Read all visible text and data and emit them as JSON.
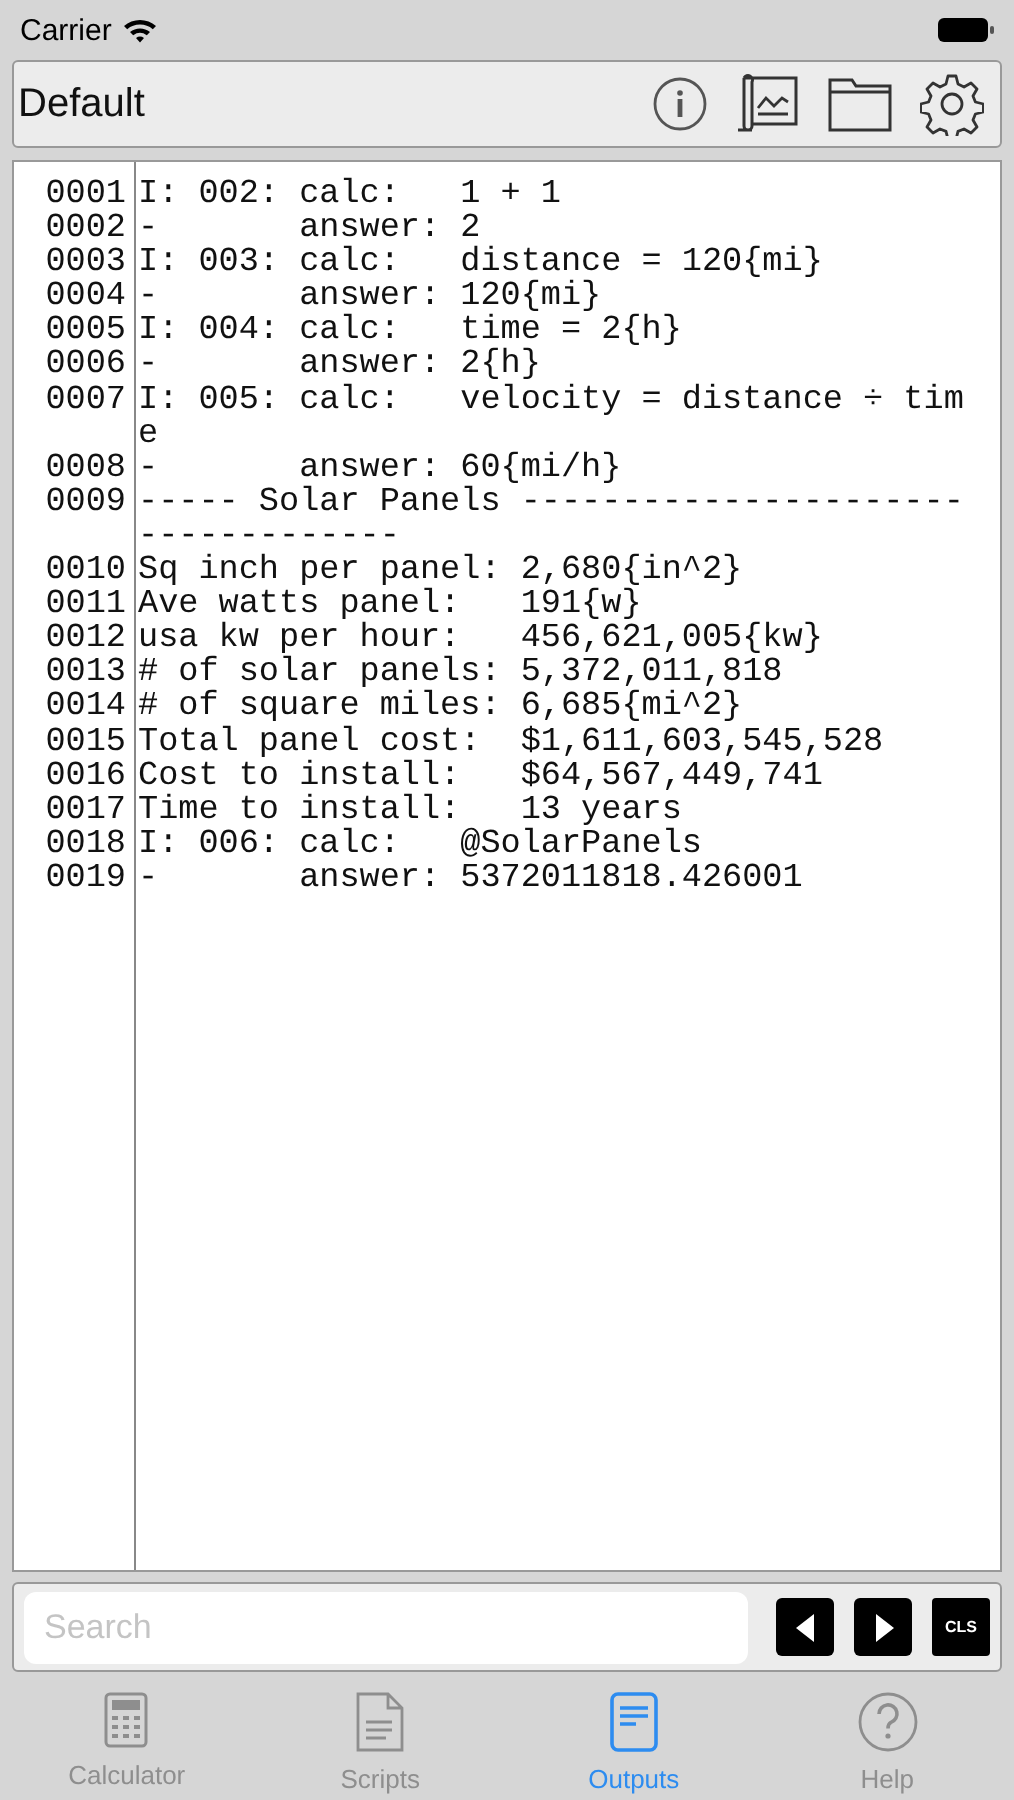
{
  "status_bar": {
    "carrier": "Carrier"
  },
  "toolbar": {
    "title": "Default"
  },
  "output": {
    "lines": [
      {
        "number": "0001",
        "text": "I: 002: calc:   1 + 1"
      },
      {
        "number": "0002",
        "text": "-       answer: 2"
      },
      {
        "number": "0003",
        "text": "I: 003: calc:   distance = 120{mi}"
      },
      {
        "number": "0004",
        "text": "-       answer: 120{mi}"
      },
      {
        "number": "0005",
        "text": "I: 004: calc:   time = 2{h}"
      },
      {
        "number": "0006",
        "text": "-       answer: 2{h}"
      },
      {
        "number": "0007",
        "text": "I: 005: calc:   velocity = distance ÷ time"
      },
      {
        "number": "0008",
        "text": "-       answer: 60{mi/h}"
      },
      {
        "number": "0009",
        "text": "----- Solar Panels -----------------------------------"
      },
      {
        "number": "0010",
        "text": "Sq inch per panel: 2,680{in^2}"
      },
      {
        "number": "0011",
        "text": "Ave watts panel:   191{w}"
      },
      {
        "number": "0012",
        "text": "usa kw per hour:   456,621,005{kw}"
      },
      {
        "number": "0013",
        "text": "# of solar panels: 5,372,011,818"
      },
      {
        "number": "0014",
        "text": "# of square miles: 6,685{mi^2}"
      },
      {
        "number": "0015",
        "text": "Total panel cost:  $1,611,603,545,528"
      },
      {
        "number": "0016",
        "text": "Cost to install:   $64,567,449,741"
      },
      {
        "number": "0017",
        "text": "Time to install:   13 years"
      },
      {
        "number": "0018",
        "text": "I: 006: calc:   @SolarPanels"
      },
      {
        "number": "0019",
        "text": "-       answer: 5372011818.426001"
      }
    ]
  },
  "search": {
    "placeholder": "Search",
    "clear_label": "CLS"
  },
  "tabs": [
    {
      "kind": "calculator",
      "label": "Calculator",
      "selected": false
    },
    {
      "kind": "scripts",
      "label": "Scripts",
      "selected": false
    },
    {
      "kind": "outputs",
      "label": "Outputs",
      "selected": true
    },
    {
      "kind": "help",
      "label": "Help",
      "selected": false
    }
  ]
}
